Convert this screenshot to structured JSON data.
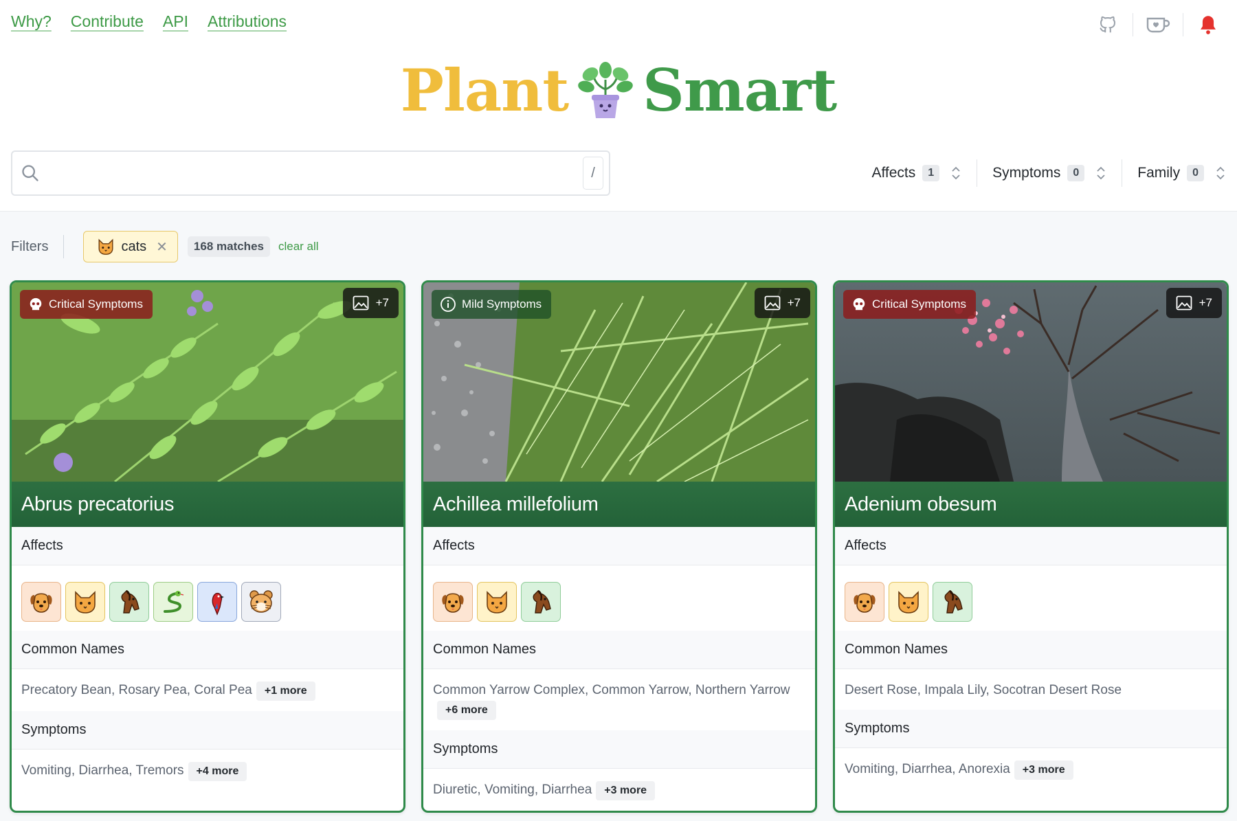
{
  "nav": {
    "links": [
      "Why?",
      "Contribute",
      "API",
      "Attributions"
    ]
  },
  "header_icons": [
    "github-icon",
    "kofi-cup-icon",
    "bell-icon"
  ],
  "logo": {
    "word1": "Plant",
    "word2": "Smart"
  },
  "search": {
    "value": "",
    "placeholder": "",
    "shortcut": "/"
  },
  "dropdowns": [
    {
      "label": "Affects",
      "count": "1"
    },
    {
      "label": "Symptoms",
      "count": "0"
    },
    {
      "label": "Family",
      "count": "0"
    }
  ],
  "filters": {
    "label": "Filters",
    "chip": {
      "label": "cats"
    },
    "matches": "168 matches",
    "clear": "clear all"
  },
  "card_labels": {
    "affects": "Affects",
    "common_names": "Common Names",
    "symptoms": "Symptoms"
  },
  "cards": [
    {
      "badge": "Critical Symptoms",
      "severity": "critical",
      "images": "+7",
      "name": "Abrus precatorius",
      "animals": [
        "dog",
        "cat",
        "horse",
        "reptile",
        "bird",
        "small-mammal"
      ],
      "common_names": "Precatory Bean, Rosary Pea, Coral Pea",
      "common_more": "+1 more",
      "symptoms": "Vomiting, Diarrhea, Tremors",
      "symptoms_more": "+4 more"
    },
    {
      "badge": "Mild Symptoms",
      "severity": "mild",
      "images": "+7",
      "name": "Achillea millefolium",
      "animals": [
        "dog",
        "cat",
        "horse"
      ],
      "common_names": "Common Yarrow Complex, Common Yarrow, Northern Yarrow",
      "common_more": "+6 more",
      "symptoms": "Diuretic, Vomiting, Diarrhea",
      "symptoms_more": "+3 more"
    },
    {
      "badge": "Critical Symptoms",
      "severity": "critical",
      "images": "+7",
      "name": "Adenium obesum",
      "animals": [
        "dog",
        "cat",
        "horse"
      ],
      "common_names": "Desert Rose, Impala Lily, Socotran Desert Rose",
      "common_more": "",
      "symptoms": "Vomiting, Diarrhea, Anorexia",
      "symptoms_more": "+3 more"
    }
  ],
  "colors": {
    "brand_green": "#3f9a4a",
    "brand_yellow": "#f0bd3c",
    "card_border": "#2f8a4a",
    "title_bar": "#2d6f41"
  }
}
